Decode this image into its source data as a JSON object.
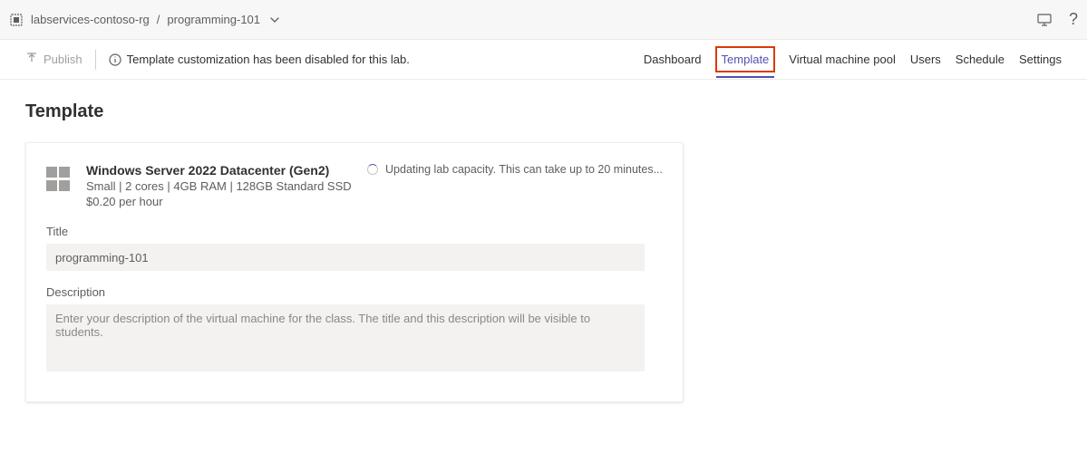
{
  "breadcrumb": {
    "rg": "labservices-contoso-rg",
    "lab": "programming-101"
  },
  "topActions": {
    "publish": "Publish"
  },
  "infoMessage": "Template customization has been disabled for this lab.",
  "tabs": {
    "dashboard": "Dashboard",
    "template": "Template",
    "vmpool": "Virtual machine pool",
    "users": "Users",
    "schedule": "Schedule",
    "settings": "Settings"
  },
  "page": {
    "title": "Template"
  },
  "vm": {
    "name": "Windows Server 2022 Datacenter (Gen2)",
    "spec": "Small | 2 cores | 4GB RAM | 128GB Standard SSD",
    "price": "$0.20 per hour"
  },
  "status": {
    "message": "Updating lab capacity. This can take up to 20 minutes..."
  },
  "form": {
    "titleLabel": "Title",
    "titleValue": "programming-101",
    "descriptionLabel": "Description",
    "descriptionPlaceholder": "Enter your description of the virtual machine for the class. The title and this description will be visible to students."
  }
}
